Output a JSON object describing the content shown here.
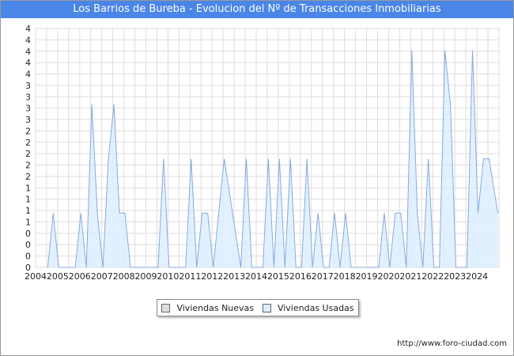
{
  "chart_data": {
    "type": "area",
    "title": "Los Barrios de Bureba - Evolucion del Nº de Transacciones Inmobiliarias",
    "xlabel": "",
    "ylabel": "",
    "x_ticks": [
      "2004",
      "2005",
      "2006",
      "2007",
      "2008",
      "2009",
      "2010",
      "2011",
      "2012",
      "2013",
      "2014",
      "2015",
      "2016",
      "2017",
      "2018",
      "2019",
      "2020",
      "2021",
      "2022",
      "2023",
      "2024"
    ],
    "y_ticks": [
      "0",
      "0",
      "0",
      "0",
      "1",
      "1",
      "1",
      "1",
      "2",
      "2",
      "2",
      "2",
      "2",
      "3",
      "3",
      "3",
      "3",
      "4",
      "4",
      "4",
      "4",
      "4"
    ],
    "ylim": [
      0,
      4.4
    ],
    "xlim": [
      2004,
      2025
    ],
    "grid": true,
    "legend_position": "bottom",
    "series": [
      {
        "name": "Viviendas Nuevas",
        "color": "#dddddd",
        "x": [
          2004.0,
          2025.0
        ],
        "values": [
          0,
          0
        ]
      },
      {
        "name": "Viviendas Usadas",
        "color": "#ddeeff",
        "line_color": "#88aadd",
        "x": [
          2004.55,
          2004.8,
          2005.05,
          2005.8,
          2006.05,
          2006.3,
          2006.55,
          2006.8,
          2007.05,
          2007.3,
          2007.55,
          2007.8,
          2008.05,
          2008.3,
          2009.55,
          2009.8,
          2010.05,
          2010.8,
          2011.05,
          2011.3,
          2011.55,
          2011.8,
          2012.05,
          2012.3,
          2012.55,
          2013.3,
          2013.55,
          2013.8,
          2014.3,
          2014.55,
          2014.8,
          2015.05,
          2015.3,
          2015.55,
          2015.8,
          2016.05,
          2016.3,
          2016.55,
          2016.8,
          2017.05,
          2017.3,
          2017.55,
          2017.8,
          2018.05,
          2018.3,
          2018.55,
          2019.55,
          2019.8,
          2020.05,
          2020.3,
          2020.55,
          2020.8,
          2021.05,
          2021.3,
          2021.55,
          2021.8,
          2022.05,
          2022.3,
          2022.55,
          2022.8,
          2023.05,
          2023.55,
          2023.8,
          2024.05,
          2024.3,
          2024.55,
          2024.95
        ],
        "values": [
          0,
          1,
          0,
          0,
          1,
          0,
          3,
          1,
          0,
          2,
          3,
          1,
          1,
          0,
          0,
          2,
          0,
          0,
          2,
          0,
          1,
          1,
          0,
          1,
          2,
          0,
          2,
          0,
          0,
          2,
          0,
          2,
          0,
          2,
          0,
          0,
          2,
          0,
          1,
          0,
          0,
          1,
          0,
          1,
          0,
          0,
          0,
          1,
          0,
          1,
          1,
          0,
          4,
          1,
          0,
          2,
          0,
          0,
          4,
          3,
          0,
          0,
          4,
          1,
          2,
          2,
          1
        ]
      }
    ]
  },
  "legend": {
    "items": [
      {
        "label": "Viviendas Nuevas",
        "color": "#dddddd"
      },
      {
        "label": "Viviendas Usadas",
        "color": "#ddeeff"
      }
    ]
  },
  "source": "http://www.foro-ciudad.com"
}
